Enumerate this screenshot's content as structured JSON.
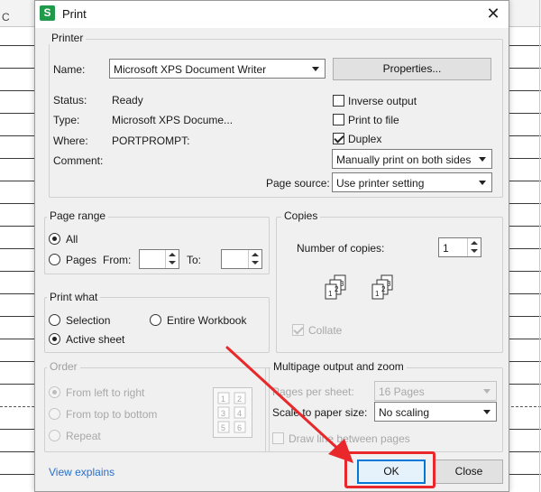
{
  "sheet": {
    "column_letter": "C"
  },
  "window": {
    "title": "Print",
    "icon_letter": "S",
    "close_glyph": "✕"
  },
  "printer": {
    "group_label": "Printer",
    "name_label": "Name:",
    "name_value": "Microsoft XPS Document Writer",
    "properties_button": "Properties...",
    "status_label": "Status:",
    "status_value": "Ready",
    "type_label": "Type:",
    "type_value": "Microsoft XPS Docume...",
    "where_label": "Where:",
    "where_value": "PORTPROMPT:",
    "comment_label": "Comment:",
    "inverse_output": {
      "label": "Inverse output",
      "checked": false
    },
    "print_to_file": {
      "label": "Print to file",
      "checked": false
    },
    "duplex": {
      "label": "Duplex",
      "checked": true
    },
    "duplex_mode": "Manually print on both sides",
    "page_source_label": "Page source:",
    "page_source_value": "Use printer setting"
  },
  "page_range": {
    "group_label": "Page range",
    "all_label": "All",
    "pages_label": "Pages",
    "from_label": "From:",
    "to_label": "To:",
    "selected": "All",
    "from_value": "",
    "to_value": ""
  },
  "copies": {
    "group_label": "Copies",
    "number_label": "Number of copies:",
    "number_value": "1",
    "collate_label": "Collate",
    "collate_checked": true,
    "collate_icon_pages_a": [
      "1",
      "2",
      "3"
    ],
    "collate_icon_pages_b": [
      "1",
      "2",
      "3"
    ]
  },
  "print_what": {
    "group_label": "Print what",
    "selection_label": "Selection",
    "entire_workbook_label": "Entire Workbook",
    "active_sheet_label": "Active sheet",
    "selected": "Active sheet"
  },
  "order": {
    "group_label": "Order",
    "left_to_right": "From left to right",
    "top_to_bottom": "From top to bottom",
    "repeat": "Repeat",
    "selected": "From left to right",
    "preview_numbers": [
      "1",
      "2",
      "3",
      "4",
      "5",
      "6"
    ]
  },
  "multipage": {
    "group_label": "Multipage output and zoom",
    "pages_per_sheet_label": "Pages per sheet:",
    "pages_per_sheet_value": "16 Pages",
    "scale_label": "Scale to paper size:",
    "scale_value": "No scaling",
    "draw_lines_label": "Draw line between pages",
    "draw_lines_checked": false
  },
  "footer": {
    "view_explains": "View explains",
    "ok_button": "OK",
    "close_button": "Close"
  },
  "colors": {
    "annotation_red": "#e8282a",
    "focus_blue": "#0078d7",
    "app_green": "#1f9a4a",
    "link_blue": "#2a6fc9"
  }
}
